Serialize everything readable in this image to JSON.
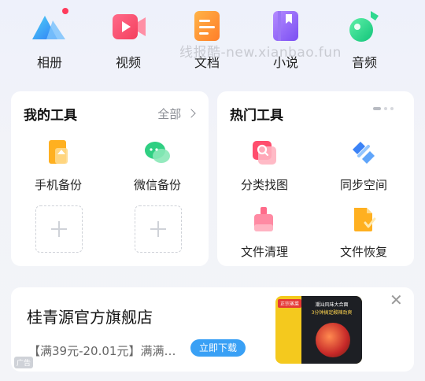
{
  "categories": [
    {
      "label": "相册",
      "icon": "album-icon"
    },
    {
      "label": "视频",
      "icon": "video-icon"
    },
    {
      "label": "文档",
      "icon": "document-icon"
    },
    {
      "label": "小说",
      "icon": "novel-icon"
    },
    {
      "label": "音频",
      "icon": "audio-icon"
    }
  ],
  "watermark": "线报酷-new.xianbao.fun",
  "my_tools": {
    "title": "我的工具",
    "all_label": "全部",
    "items": [
      {
        "label": "手机备份",
        "icon": "phone-backup-icon"
      },
      {
        "label": "微信备份",
        "icon": "wechat-backup-icon"
      }
    ]
  },
  "hot_tools": {
    "title": "热门工具",
    "items": [
      {
        "label": "分类找图",
        "icon": "image-search-icon"
      },
      {
        "label": "同步空间",
        "icon": "sync-icon"
      },
      {
        "label": "文件清理",
        "icon": "file-clean-icon"
      },
      {
        "label": "文件恢复",
        "icon": "file-restore-icon"
      }
    ]
  },
  "ad": {
    "title": "桂青源官方旗舰店",
    "desc": "【满39元-20.01元】满满…",
    "button": "立即下载",
    "tag": "广告",
    "image_banner_small": "正宗蒸菜",
    "image_banner_top": "潮汕风味大合面",
    "image_banner_mid": "3分钟搞定酸辣劲爽"
  },
  "colors": {
    "accent": "#39a0f5"
  }
}
